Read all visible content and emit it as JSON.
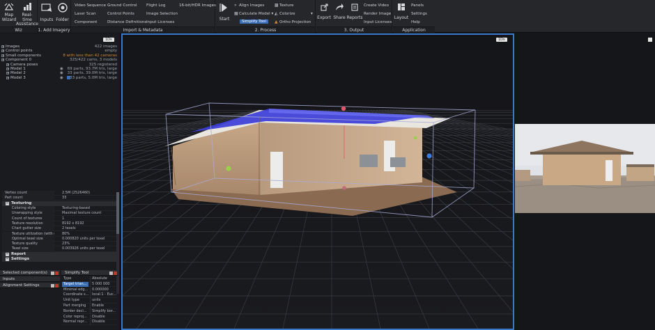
{
  "ribbon": {
    "sections": [
      {
        "id": "wiz",
        "label": "Wiz"
      },
      {
        "id": "add",
        "label": "1. Add Imagery"
      },
      {
        "id": "import",
        "label": "Import & Metadata"
      },
      {
        "id": "process",
        "label": "2. Process"
      },
      {
        "id": "output",
        "label": "3. Output"
      },
      {
        "id": "app",
        "label": "Application"
      }
    ],
    "wiz": {
      "map_wizard_1": "Map",
      "map_wizard_2": "Wizard",
      "realtime_1": "Real-time",
      "realtime_2": "Assistance"
    },
    "add": {
      "inputs": "Inputs",
      "folder": "Folder"
    },
    "import": {
      "col1": [
        "Video Sequence",
        "Laser Scan",
        "Component"
      ],
      "col2": [
        "Ground Control",
        "Control Points",
        "Distance Definitions"
      ],
      "col3": [
        "Flight Log",
        "Image Selection",
        "Input Licenses"
      ],
      "col4": [
        "16-bit/HDR Images"
      ]
    },
    "process": {
      "start": "Start",
      "col1": [
        "Align Images",
        "Calculate Model",
        "Simplify Tool"
      ],
      "col2": [
        "Texture",
        "Colorize",
        "Ortho Projection"
      ],
      "dropdown_mark": "▾",
      "more_mark": "▾"
    },
    "output": {
      "export": "Export",
      "share": "Share",
      "reports": "Reports",
      "col": [
        "Create Video",
        "Render Image",
        "Input Licenses"
      ]
    },
    "app": {
      "layout": "Layout",
      "col": [
        "Panels",
        "Settings",
        "Help"
      ]
    }
  },
  "left": {
    "zoom_badge": "1Ds",
    "tree": [
      {
        "label": "Images",
        "value": "422 images",
        "indent": 0,
        "color": ""
      },
      {
        "label": "Control points",
        "value": "empty",
        "indent": 0,
        "color": ""
      },
      {
        "label": "Small components",
        "value": "8 with less than 42 cameras",
        "indent": 0,
        "color": "orange"
      },
      {
        "label": "Component 0",
        "value": "325/422 cams, 3 models",
        "indent": 0,
        "color": ""
      },
      {
        "label": "Camera poses",
        "value": "325 registered",
        "indent": 1,
        "color": ""
      },
      {
        "label": "Model 1",
        "value": "69 parts, 93.7M tris, large",
        "indent": 1,
        "color": ""
      },
      {
        "label": "Model 2",
        "value": "33 parts, 39.0M tris, large",
        "indent": 1,
        "color": ""
      },
      {
        "label": "Model 3",
        "value": "33 parts, 5.0M tris, large",
        "indent": 1,
        "color": ""
      }
    ],
    "properties": [
      {
        "k": "Vertex count",
        "v": "2.5M (2526460)",
        "indent": 0
      },
      {
        "k": "Part count",
        "v": "33",
        "indent": 0
      }
    ],
    "texturing_label": "Texturing",
    "texturing_rows": [
      {
        "k": "Coloring style",
        "v": "Texturing-based"
      },
      {
        "k": "Unwrapping style",
        "v": "Maximal texture count"
      },
      {
        "k": "Count of textures",
        "v": "1"
      },
      {
        "k": "Texture resolution",
        "v": "8192 x 8192"
      },
      {
        "k": "Chart gutter size",
        "v": "2 texels"
      },
      {
        "k": "Texture utilization (with gut...",
        "v": "80%"
      },
      {
        "k": "Optimal texel size",
        "v": "0.000820 units per texel"
      },
      {
        "k": "Texture quality",
        "v": "23%"
      },
      {
        "k": "Texel size",
        "v": "0.003926 units per texel"
      }
    ],
    "report_label": "Report",
    "settings_label": "Settings",
    "selected_component": "Selected component(s)",
    "inputs_label": "Inputs",
    "alignment_settings": "Alignment Settings",
    "simplify_title": "Simplify Tool",
    "simplify_rows": [
      {
        "k": "Type",
        "v": "Absolute",
        "sel": false
      },
      {
        "k": "Target trian...",
        "v": "5 000 000",
        "sel": true
      },
      {
        "k": "Minimal edg...",
        "v": "0.000000",
        "sel": false
      },
      {
        "k": "Coordinate s...",
        "v": "local:1 - Euc...",
        "sel": false
      },
      {
        "k": "Unit type",
        "v": "units",
        "sel": false
      },
      {
        "k": "Part merging",
        "v": "Enable",
        "sel": false
      },
      {
        "k": "Border deci...",
        "v": "Simplify bor...",
        "sel": false
      },
      {
        "k": "Color reproj...",
        "v": "Disable",
        "sel": false
      },
      {
        "k": "Normal repr...",
        "v": "Disable",
        "sel": false
      }
    ]
  },
  "viewport": {
    "badge": "1Ds"
  },
  "side": {
    "badge": ""
  },
  "colors": {
    "accent": "#3a78c9",
    "selection": "#3a6fb5",
    "orange": "#d08a3a",
    "red": "#c0392b"
  }
}
